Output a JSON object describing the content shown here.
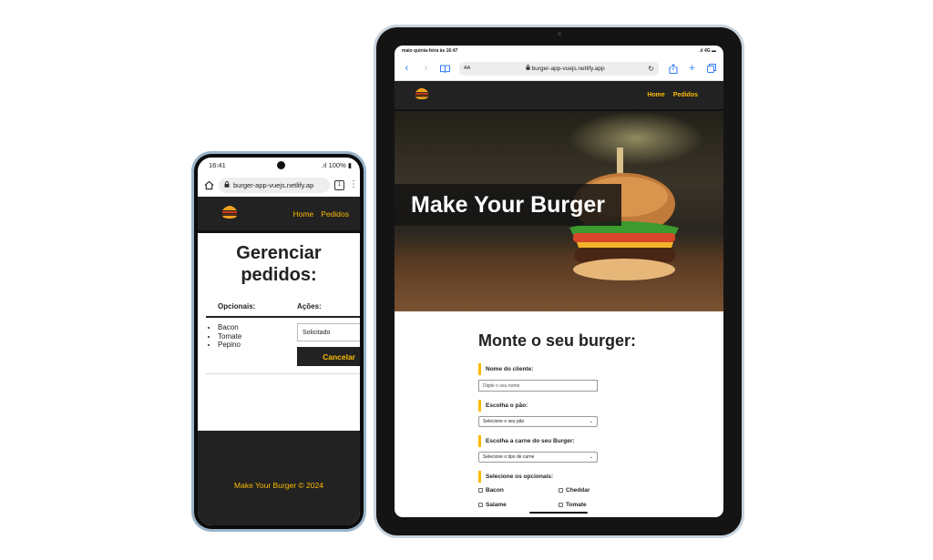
{
  "phone": {
    "status": {
      "time": "16:41",
      "battery": "100%"
    },
    "browser": {
      "url": "burger-app-vuejs.netlify.ap",
      "tab_count": "1"
    },
    "nav": {
      "links": [
        "Home",
        "Pedidos"
      ]
    },
    "page_title": "Gerenciar pedidos:",
    "table": {
      "headers": [
        "Opcionais:",
        "Ações:"
      ],
      "row": {
        "opcionais": [
          "Bacon",
          "Tomate",
          "Pepino"
        ],
        "status_value": "Solicitado",
        "cancel_label": "Cancelar"
      }
    },
    "footer": "Make Your Burger © 2024"
  },
  "tablet": {
    "status": {
      "time": "maio quinta-feira às 16:47",
      "network": "4G"
    },
    "browser": {
      "aa": "AA",
      "url": "burger-app-vuejs.netlify.app"
    },
    "nav": {
      "links": [
        "Home",
        "Pedidos"
      ]
    },
    "hero_title": "Make Your Burger",
    "form": {
      "heading": "Monte o seu burger:",
      "name_label": "Nome do cliente:",
      "name_placeholder": "Digite o seu nome",
      "bread_label": "Escolha o pão:",
      "bread_select": "Selecione o seu pão",
      "meat_label": "Escolha a carne do seu Burger:",
      "meat_select": "Selecione o tipo de carne",
      "optionals_label": "Selecione os opcionais:",
      "optionals": [
        "Bacon",
        "Cheddar",
        "Salame",
        "Tomate"
      ]
    }
  },
  "colors": {
    "nav_bg": "#222222",
    "accent": "#fcba03"
  },
  "icons": [
    "burger-logo-icon",
    "lock-icon",
    "home-icon",
    "tabs-icon",
    "menu-dots-icon",
    "back-icon",
    "forward-icon",
    "book-icon",
    "reload-icon",
    "share-icon",
    "plus-icon",
    "copy-tabs-icon",
    "checkbox-icon",
    "chevron-down-icon"
  ]
}
